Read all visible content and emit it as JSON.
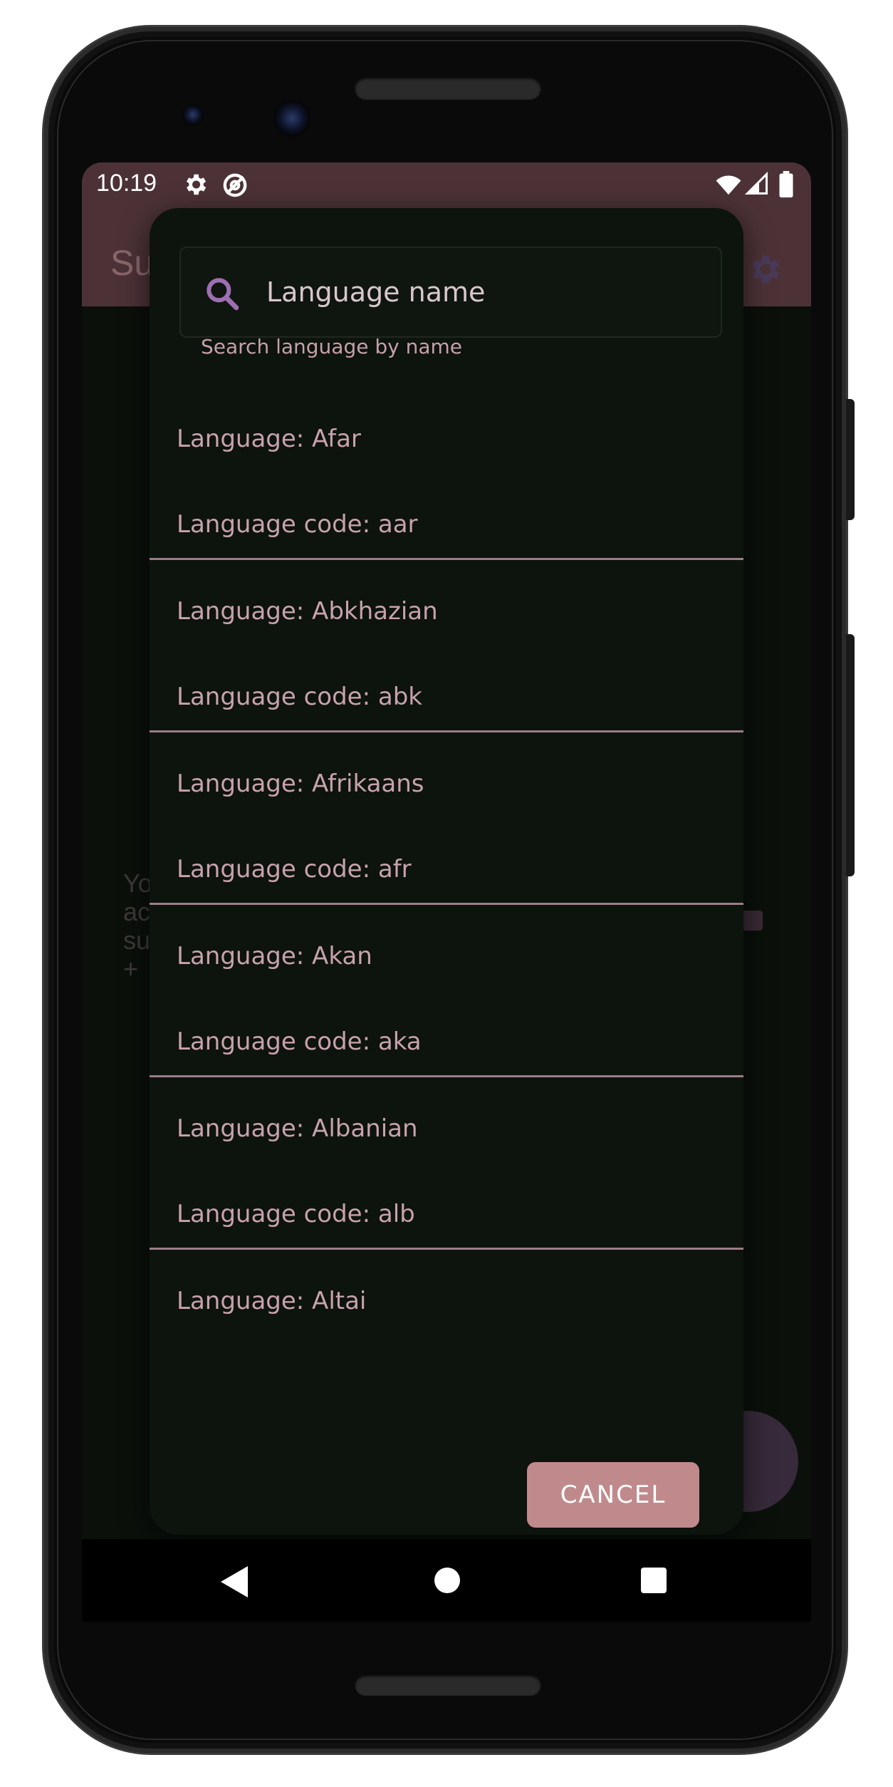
{
  "status_bar": {
    "time": "10:19"
  },
  "app_bar": {
    "title_partial": "Su"
  },
  "background": {
    "text_lines": [
      "Yo",
      "ac",
      "su",
      "+"
    ]
  },
  "dialog": {
    "search": {
      "placeholder": "Language name",
      "helper_text": "Search language by name"
    },
    "items": [
      {
        "name": "Language: Afar",
        "code": "Language code: aar"
      },
      {
        "name": "Language: Abkhazian",
        "code": "Language code: abk"
      },
      {
        "name": "Language: Afrikaans",
        "code": "Language code: afr"
      },
      {
        "name": "Language: Akan",
        "code": "Language code: aka"
      },
      {
        "name": "Language: Albanian",
        "code": "Language code: alb"
      },
      {
        "name": "Language: Altai",
        "code": ""
      }
    ],
    "cancel_label": "CANCEL"
  },
  "colors": {
    "status_bar": "#4c3237",
    "dialog_bg": "#0d130d",
    "accent": "#c08a8c",
    "list_text": "#c7a2ad",
    "divider": "#9a7d88",
    "search_icon": "#9c6fb0"
  },
  "icons": [
    "settings-icon",
    "sync-off-icon",
    "wifi-icon",
    "signal-icon",
    "battery-icon",
    "search-icon",
    "back-icon",
    "home-icon",
    "recents-icon"
  ]
}
